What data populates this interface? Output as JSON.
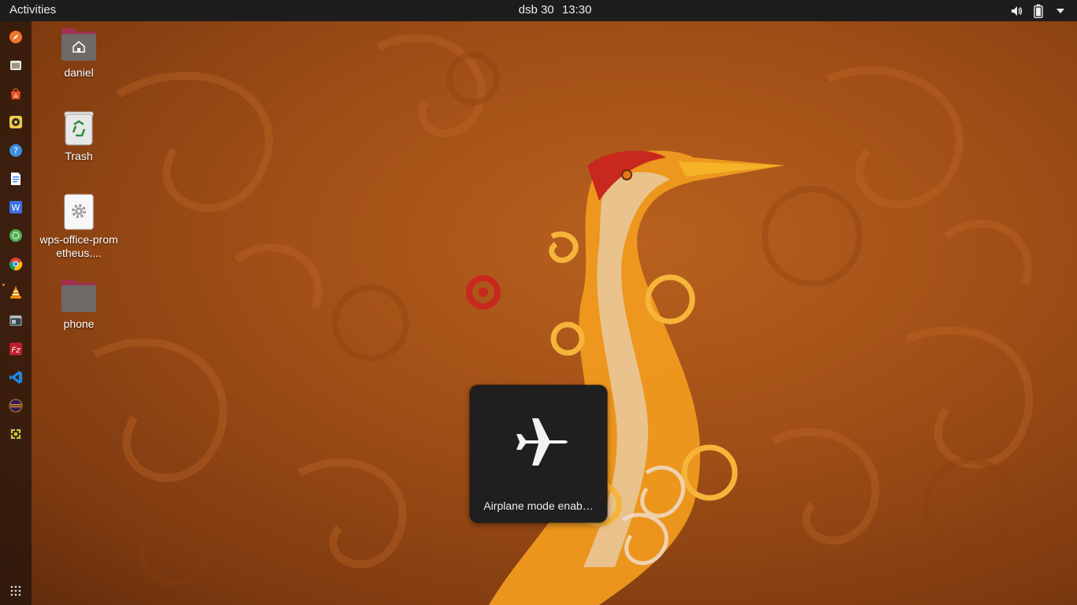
{
  "topbar": {
    "activities_label": "Activities",
    "clock_day": "dsb 30",
    "clock_time": "13:30",
    "icons": [
      "speaker-icon",
      "battery-icon",
      "chevron-down-icon"
    ]
  },
  "dock": {
    "items": [
      {
        "icon": "compass-icon",
        "color": "#f0742d"
      },
      {
        "icon": "file-manager-icon",
        "color": "#e8e4dc"
      },
      {
        "icon": "software-center-icon",
        "color": "#e95420"
      },
      {
        "icon": "rhythmbox-icon",
        "color": "#f2c94c"
      },
      {
        "icon": "help-icon",
        "color": "#3d8fe0"
      },
      {
        "icon": "writer-icon",
        "color": "#2a7de1"
      },
      {
        "icon": "wps-writer-icon",
        "color": "#3b6fe3"
      },
      {
        "icon": "network-icon",
        "color": "#4caf50"
      },
      {
        "icon": "chrome-icon",
        "color": "#fbbc05"
      },
      {
        "icon": "vlc-icon",
        "color": "#f08a00"
      },
      {
        "icon": "terminal-window-icon",
        "color": "#b0bec5"
      },
      {
        "icon": "filezilla-icon",
        "color": "#bf1e2d"
      },
      {
        "icon": "vscode-icon",
        "color": "#1e88e5"
      },
      {
        "icon": "eclipse-icon",
        "color": "#2c2255"
      },
      {
        "icon": "screenshot-icon",
        "color": "#f9c416"
      },
      {
        "icon": "app-grid-icon",
        "color": "#dddddd"
      }
    ]
  },
  "desktop": {
    "icons": [
      {
        "label": "daniel",
        "icon": "home-folder-icon"
      },
      {
        "label": "Trash",
        "icon": "trash-icon"
      },
      {
        "label": "wps-office-prometheus....",
        "icon": "settings-file-icon"
      },
      {
        "label": "phone",
        "icon": "folder-icon"
      }
    ]
  },
  "osd": {
    "icon": "airplane-icon",
    "label": "Airplane mode enab…"
  }
}
